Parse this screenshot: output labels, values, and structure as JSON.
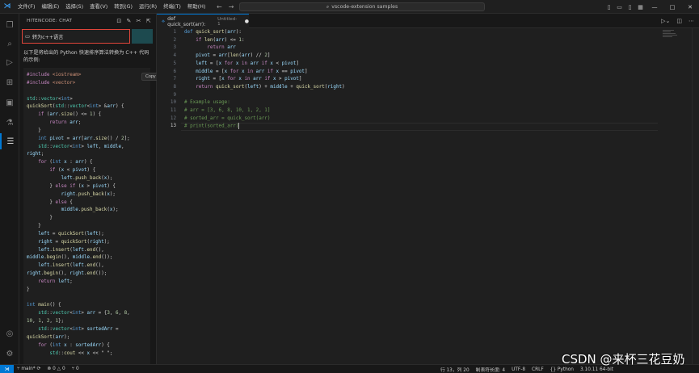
{
  "titlebar": {
    "menu": [
      "文件(F)",
      "编辑(E)",
      "选择(S)",
      "查看(V)",
      "转到(G)",
      "运行(R)",
      "终端(T)",
      "帮助(H)"
    ],
    "search_text": "vscode-extension samples",
    "search_icon": "search-icon"
  },
  "sidebar": {
    "header": "HITENCODE: CHAT",
    "input_text": "转为c++语言",
    "description": "以下是将给出的 Python 快速排序算法转换为 C++ 代码的示例:",
    "copy_label": "Copy",
    "code_lines": [
      {
        "t": "#include <iostream>",
        "c": "pp"
      },
      {
        "t": "#include <vector>",
        "c": "pp"
      },
      {
        "t": "",
        "c": ""
      },
      {
        "t": "std::vector<int>",
        "c": "ty"
      },
      {
        "t": "quickSort(std::vector<int> &arr) {",
        "c": ""
      },
      {
        "t": "    if (arr.size() <= 1) {",
        "c": ""
      },
      {
        "t": "        return arr;",
        "c": ""
      },
      {
        "t": "    }",
        "c": ""
      },
      {
        "t": "    int pivot = arr[arr.size() / 2];",
        "c": ""
      },
      {
        "t": "    std::vector<int> left, middle,",
        "c": ""
      },
      {
        "t": "right;",
        "c": ""
      },
      {
        "t": "    for (int x : arr) {",
        "c": ""
      },
      {
        "t": "        if (x < pivot) {",
        "c": ""
      },
      {
        "t": "            left.push_back(x);",
        "c": ""
      },
      {
        "t": "        } else if (x > pivot) {",
        "c": ""
      },
      {
        "t": "            right.push_back(x);",
        "c": ""
      },
      {
        "t": "        } else {",
        "c": ""
      },
      {
        "t": "            middle.push_back(x);",
        "c": ""
      },
      {
        "t": "        }",
        "c": ""
      },
      {
        "t": "    }",
        "c": ""
      },
      {
        "t": "    left = quickSort(left);",
        "c": ""
      },
      {
        "t": "    right = quickSort(right);",
        "c": ""
      },
      {
        "t": "    left.insert(left.end(),",
        "c": ""
      },
      {
        "t": "middle.begin(), middle.end());",
        "c": ""
      },
      {
        "t": "    left.insert(left.end(),",
        "c": ""
      },
      {
        "t": "right.begin(), right.end());",
        "c": ""
      },
      {
        "t": "    return left;",
        "c": ""
      },
      {
        "t": "}",
        "c": ""
      },
      {
        "t": "",
        "c": ""
      },
      {
        "t": "int main() {",
        "c": ""
      },
      {
        "t": "    std::vector<int> arr = {3, 6, 8,",
        "c": ""
      },
      {
        "t": "10, 1, 2, 1};",
        "c": ""
      },
      {
        "t": "    std::vector<int> sortedArr =",
        "c": ""
      },
      {
        "t": "quickSort(arr);",
        "c": ""
      },
      {
        "t": "    for (int x : sortedArr) {",
        "c": ""
      },
      {
        "t": "        std::cout << x << \" \";",
        "c": ""
      }
    ]
  },
  "editor": {
    "tab_label": "def quick_sort(arr):",
    "tab_subtitle": "Untitled-1",
    "tab_dirty": "●",
    "line_numbers": [
      "1",
      "2",
      "3",
      "4",
      "5",
      "6",
      "7",
      "8",
      "9",
      "10",
      "11",
      "12",
      "13"
    ],
    "lines": [
      "def quick_sort(arr):",
      "    if len(arr) <= 1:",
      "        return arr",
      "    pivot = arr[len(arr) // 2]",
      "    left = [x for x in arr if x < pivot]",
      "    middle = [x for x in arr if x == pivot]",
      "    right = [x for x in arr if x > pivot]",
      "    return quick_sort(left) + middle + quick_sort(right)",
      "",
      "# Example usage:",
      "# arr = [3, 6, 8, 10, 1, 2, 1]",
      "# sorted_arr = quick_sort(arr)",
      "# print(sorted_arr)"
    ]
  },
  "statusbar": {
    "branch": "main*",
    "sync_icon": "sync-icon",
    "problems": "⊗ 0 △ 0",
    "ports": "⑂ 0",
    "position": "行 13，列 20",
    "indent": "制表符长度: 4",
    "encoding": "UTF-8",
    "eol": "CRLF",
    "language": "{} Python",
    "interpreter": "3.10.11 64-bit"
  },
  "watermark": "CSDN @来杯三花豆奶",
  "colors": {
    "accent": "#0078d4",
    "highlight_border": "#e0453a",
    "teal_panel": "#1d4a4f"
  }
}
